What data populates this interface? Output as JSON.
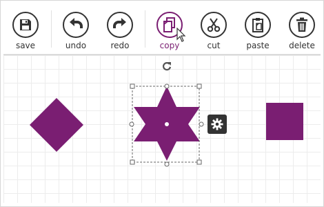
{
  "toolbar": {
    "tools": [
      {
        "id": "save",
        "label": "save",
        "icon": "floppy-disk-icon",
        "active": false
      },
      {
        "id": "undo",
        "label": "undo",
        "icon": "undo-arrow-icon",
        "active": false
      },
      {
        "id": "redo",
        "label": "redo",
        "icon": "redo-arrow-icon",
        "active": false
      },
      {
        "id": "copy",
        "label": "copy",
        "icon": "copy-icon",
        "active": true
      },
      {
        "id": "cut",
        "label": "cut",
        "icon": "scissors-icon",
        "active": false
      },
      {
        "id": "paste",
        "label": "paste",
        "icon": "clipboard-icon",
        "active": false
      },
      {
        "id": "delete",
        "label": "delete",
        "icon": "trash-icon",
        "active": false
      }
    ]
  },
  "canvas": {
    "shapes": [
      {
        "type": "diamond",
        "selected": false
      },
      {
        "type": "six-point-star",
        "selected": true
      },
      {
        "type": "square",
        "selected": false
      }
    ]
  },
  "colors": {
    "accent": "#7a1e72",
    "shape_fill": "#7a1e72",
    "icon_stroke": "#333333",
    "grid": "#ececec"
  },
  "selection": {
    "rotate_icon": "rotate-icon",
    "settings_icon": "gear-icon"
  }
}
